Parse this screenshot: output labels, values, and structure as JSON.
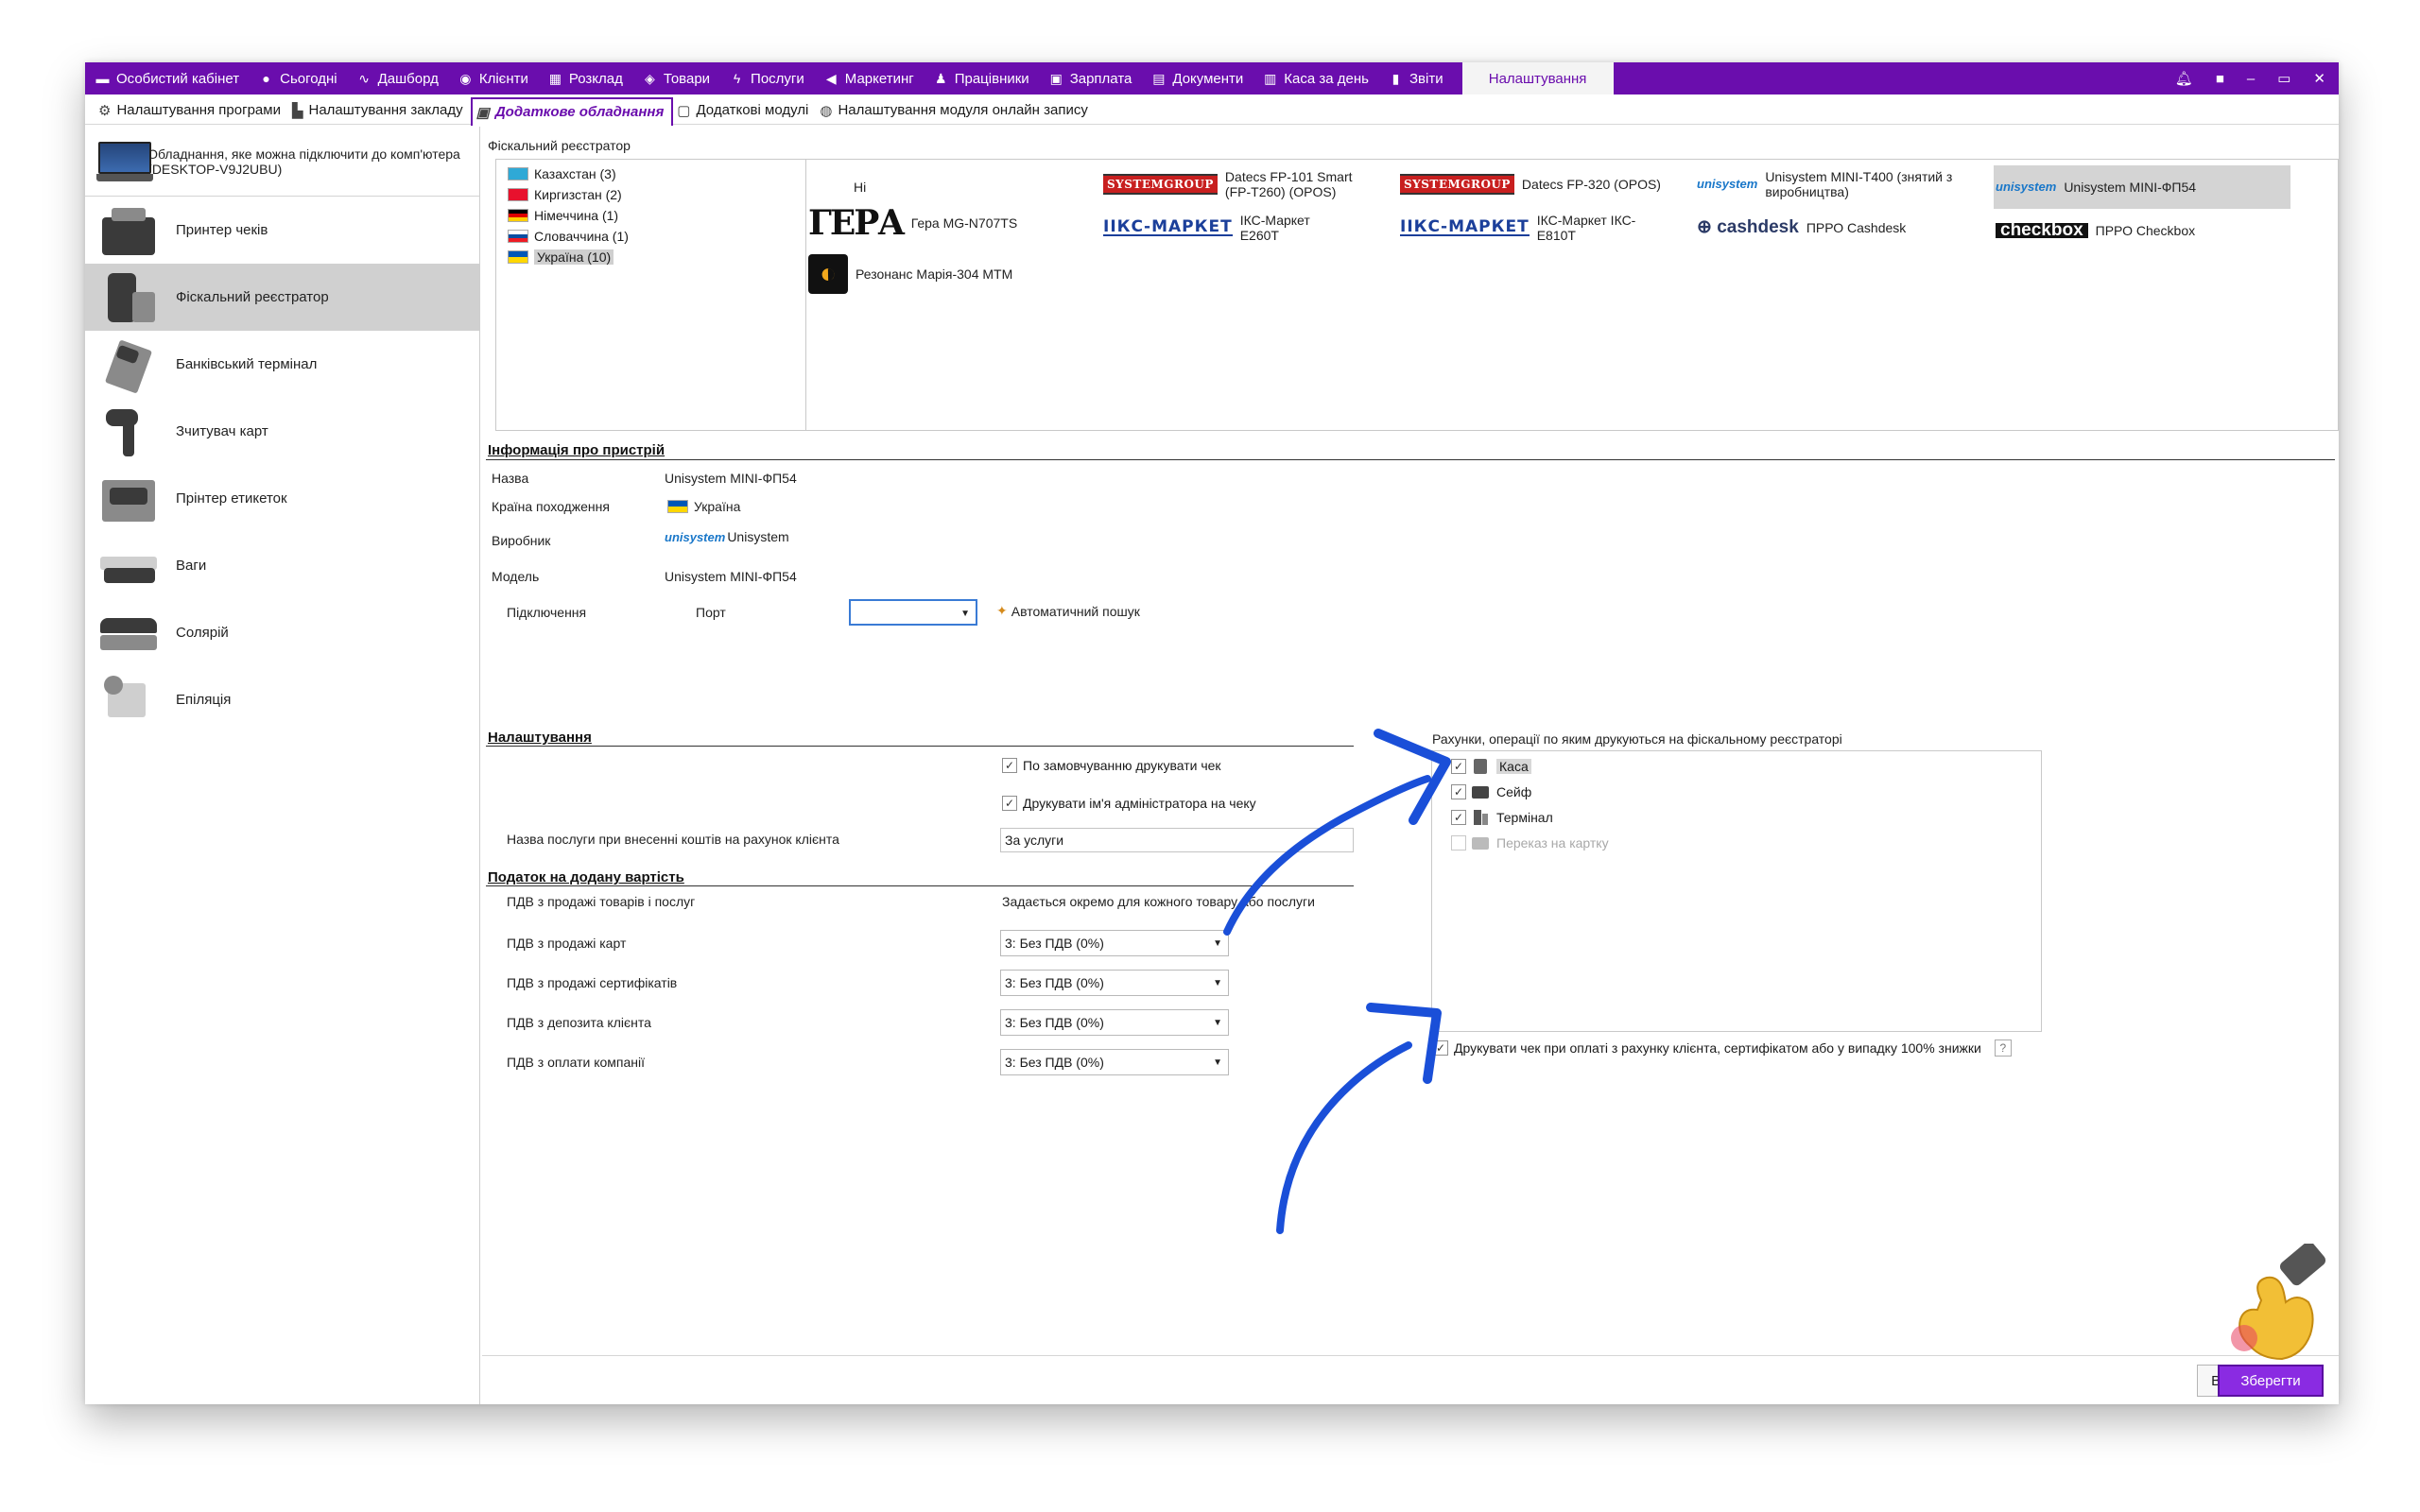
{
  "topnav": {
    "items": [
      {
        "icon": "briefcase-icon",
        "label": "Особистий кабінет"
      },
      {
        "icon": "today-icon",
        "label": "Сьогодні"
      },
      {
        "icon": "pulse-icon",
        "label": "Дашборд"
      },
      {
        "icon": "user-circle-icon",
        "label": "Клієнти"
      },
      {
        "icon": "calendar-icon",
        "label": "Розклад"
      },
      {
        "icon": "box-icon",
        "label": "Товари"
      },
      {
        "icon": "lightning-icon",
        "label": "Послуги"
      },
      {
        "icon": "megaphone-icon",
        "label": "Маркетинг"
      },
      {
        "icon": "person-icon",
        "label": "Працівники"
      },
      {
        "icon": "money-icon",
        "label": "Зарплата"
      },
      {
        "icon": "document-icon",
        "label": "Документи"
      },
      {
        "icon": "calculator-icon",
        "label": "Каса за день"
      },
      {
        "icon": "bar-chart-icon",
        "label": "Звіти"
      }
    ],
    "active": "Налаштування"
  },
  "subnav": {
    "items": [
      {
        "icon": "gear-icon",
        "label": "Налаштування програми"
      },
      {
        "icon": "building-icon",
        "label": "Налаштування закладу"
      },
      {
        "icon": "printer-icon",
        "label": "Додаткове обладнання",
        "active": true
      },
      {
        "icon": "modules-icon",
        "label": "Додаткові модулі"
      },
      {
        "icon": "globe-icon",
        "label": "Налаштування модуля онлайн запису"
      }
    ]
  },
  "sidebar": {
    "header": "Обладнання, яке можна підключити до комп'ютера (DESKTOP-V9J2UBU)",
    "items": [
      {
        "label": "Принтер чеків",
        "icon": "receipt-printer-icon"
      },
      {
        "label": "Фіскальний реєстратор",
        "icon": "fiscal-register-icon",
        "active": true
      },
      {
        "label": "Банківський термінал",
        "icon": "bank-terminal-icon"
      },
      {
        "label": "Зчитувач карт",
        "icon": "card-reader-icon"
      },
      {
        "label": "Прінтер етикеток",
        "icon": "label-printer-icon"
      },
      {
        "label": "Ваги",
        "icon": "scales-icon"
      },
      {
        "label": "Солярій",
        "icon": "solarium-icon"
      },
      {
        "label": "Епіляція",
        "icon": "epilation-icon"
      }
    ]
  },
  "fiscal": {
    "section_label": "Фіскальний реєстратор",
    "countries": [
      {
        "label": "Казахстан (3)",
        "flag": "kz"
      },
      {
        "label": "Киргизстан (2)",
        "flag": "kg"
      },
      {
        "label": "Німеччина (1)",
        "flag": "de"
      },
      {
        "label": "Словаччина (1)",
        "flag": "sk"
      },
      {
        "label": "Україна (10)",
        "flag": "ua",
        "selected": true
      }
    ],
    "models": {
      "none": "Ні",
      "gera_logo": "ГЕРА",
      "gera": "Гера MG-N707TS",
      "rezonans": "Резонанс Марія-304 МТМ",
      "sg_logo": "SYSTEMGROUP",
      "datecs1": "Datecs FP-101 Smart (FP-T260) (OPOS)",
      "iks_logo": "IIКС-МАРКЕТ",
      "iks1": "ІКС-Маркет E260T",
      "datecs2": "Datecs FP-320 (OPOS)",
      "iks2": "ІКС-Маркет ІКС-E810T",
      "unis_logo": "unisystem",
      "unis1": "Unisystem MINI-T400 (знятий з виробництва)",
      "cash_logo": "cashdesk",
      "cashdesk": "ПРРО Cashdesk",
      "unis2": "Unisystem MINI-ФП54",
      "checkbox_logo": "checkbox",
      "checkbox": "ПРРО Checkbox"
    }
  },
  "device_info": {
    "title": "Інформація про пристрій",
    "name_label": "Назва",
    "name": "Unisystem MINI-ФП54",
    "country_label": "Країна походження",
    "country": "Україна",
    "manufacturer_label": "Виробник",
    "manufacturer": "Unisystem",
    "model_label": "Модель",
    "model": "Unisystem MINI-ФП54",
    "connection_label": "Підключення",
    "port_label": "Порт",
    "port_value": "",
    "auto_search": "Автоматичний пошук"
  },
  "settings": {
    "title": "Налаштування",
    "print_default": "По замовчуванню друкувати чек",
    "print_admin": "Друкувати ім'я адміністратора на чеку",
    "service_name_label": "Назва послуги при внесенні коштів на рахунок клієнта",
    "service_name_value": "За услуги"
  },
  "vat": {
    "title": "Податок на додану вартість",
    "rows": [
      {
        "label": "ПДВ з продажі товарів і послуг",
        "value": "Задається окремо для кожного товару або послуги",
        "type": "text"
      },
      {
        "label": "ПДВ з продажі карт",
        "value": "3: Без ПДВ (0%)",
        "type": "select"
      },
      {
        "label": "ПДВ з продажі сертифікатів",
        "value": "3: Без ПДВ (0%)",
        "type": "select"
      },
      {
        "label": "ПДВ з депозита клієнта",
        "value": "3: Без ПДВ (0%)",
        "type": "select"
      },
      {
        "label": "ПДВ з оплати компанії",
        "value": "3: Без ПДВ (0%)",
        "type": "select"
      }
    ]
  },
  "operations": {
    "title": "Рахунки, операції по яким друкуються на фіскальному реєстраторі",
    "items": [
      {
        "label": "Каса",
        "checked": true,
        "icon": "cash-register-icon"
      },
      {
        "label": "Сейф",
        "checked": true,
        "icon": "safe-icon"
      },
      {
        "label": "Термінал",
        "checked": true,
        "icon": "terminal-icon"
      },
      {
        "label": "Переказ на картку",
        "checked": false,
        "disabled": true,
        "icon": "card-transfer-icon"
      }
    ],
    "print_on_account": "Друкувати чек при оплаті з рахунку клієнта, сертифікатом або у випадку 100% знижки",
    "help": "?"
  },
  "buttons": {
    "cancel": "Відмінити",
    "save": "Зберегти"
  },
  "colors": {
    "brand": "#6a0dad",
    "accent_arrow": "#1a4fd8",
    "save": "#8a2be2"
  },
  "check_mark": "✓"
}
